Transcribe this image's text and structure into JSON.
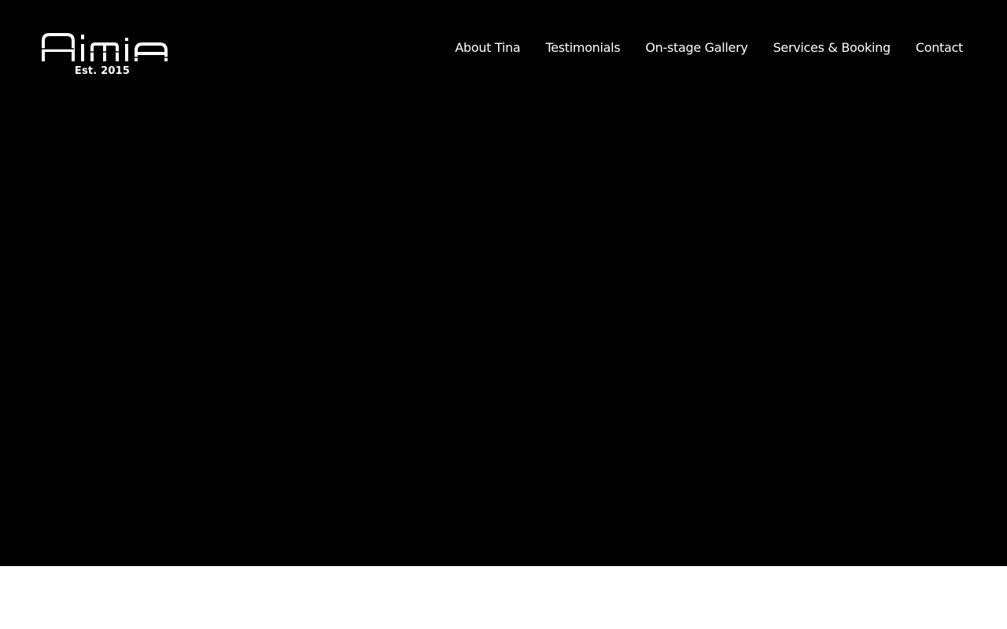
{
  "brand": {
    "logo_text": "AimiA",
    "tagline": "Est. 2015",
    "logo_color": "#ffffff"
  },
  "nav": {
    "items": [
      {
        "label": "About Tina"
      },
      {
        "label": "Testimonials"
      },
      {
        "label": "On-stage Gallery"
      },
      {
        "label": "Services & Booking"
      },
      {
        "label": "Contact"
      }
    ]
  },
  "theme": {
    "hero_background": "#000000",
    "page_background": "#ffffff",
    "text_color": "#ffffff"
  }
}
